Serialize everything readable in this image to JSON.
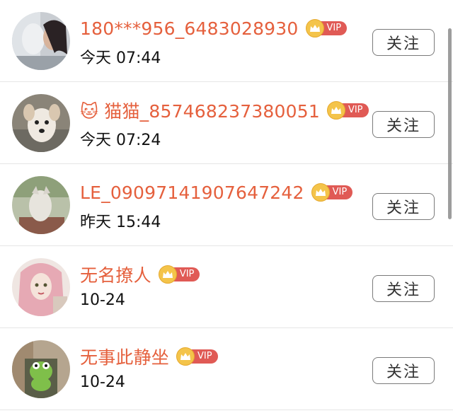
{
  "follow_list": {
    "items": [
      {
        "emoji": "",
        "name": "180***956_6483028930",
        "vip": "VIP",
        "time": "今天 07:44",
        "follow_label": "关注"
      },
      {
        "emoji": "🐱",
        "name": "猫猫_857468237380051",
        "vip": "VIP",
        "time": "今天 07:24",
        "follow_label": "关注"
      },
      {
        "emoji": "",
        "name": "LE_09097141907647242",
        "vip": "VIP",
        "time": "昨天 15:44",
        "follow_label": "关注"
      },
      {
        "emoji": "",
        "name": "无名撩人",
        "vip": "VIP",
        "time": "10-24",
        "follow_label": "关注"
      },
      {
        "emoji": "",
        "name": "无事此静坐",
        "vip": "VIP",
        "time": "10-24",
        "follow_label": "关注"
      }
    ]
  },
  "colors": {
    "name": "#e5603d",
    "vip_tag": "#e05a55",
    "crown": "#f4c44a",
    "divider": "#e6e6e6"
  }
}
